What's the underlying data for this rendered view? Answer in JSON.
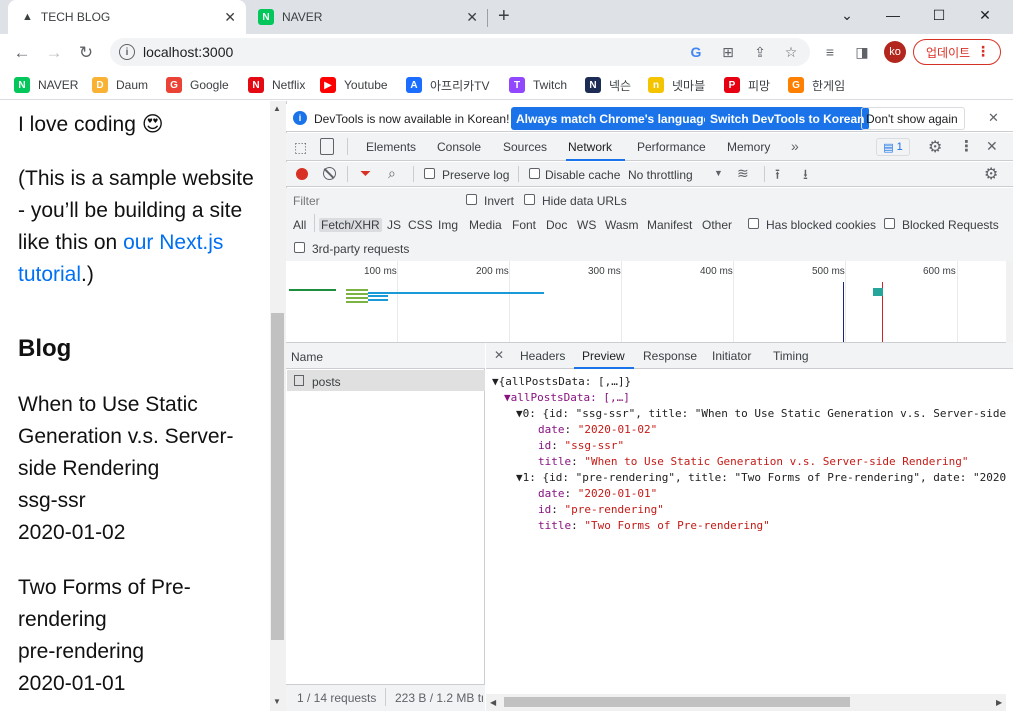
{
  "tabs": [
    {
      "title": "TECH BLOG",
      "close": "✕"
    },
    {
      "title": "NAVER",
      "close": "✕"
    }
  ],
  "new_tab": "+",
  "window_controls": [
    "⌄",
    "—",
    "☐",
    "✕"
  ],
  "address_bar": {
    "url": "localhost:3000"
  },
  "update_button": "업데이트",
  "profile_initials": "ko",
  "bookmarks": [
    {
      "label": "NAVER",
      "icon": "naver-icon",
      "color": "#03c75a",
      "glyph": "N"
    },
    {
      "label": "Daum",
      "icon": "daum-icon",
      "color": "#f9b233",
      "glyph": "D"
    },
    {
      "label": "Google",
      "icon": "google-icon",
      "color": "#ea4335",
      "glyph": "G"
    },
    {
      "label": "Netflix",
      "icon": "netflix-icon",
      "color": "#e50914",
      "glyph": "N"
    },
    {
      "label": "Youtube",
      "icon": "youtube-icon",
      "color": "#ff0000",
      "glyph": "▶"
    },
    {
      "label": "아프리카TV",
      "icon": "afreecatv-icon",
      "color": "#1a6dff",
      "glyph": "A"
    },
    {
      "label": "Twitch",
      "icon": "twitch-icon",
      "color": "#9146ff",
      "glyph": "T"
    },
    {
      "label": "넥슨",
      "icon": "nexon-icon",
      "color": "#1c2c54",
      "glyph": "N"
    },
    {
      "label": "넷마블",
      "icon": "netmarble-icon",
      "color": "#f5c400",
      "glyph": "n"
    },
    {
      "label": "피망",
      "icon": "pmang-icon",
      "color": "#e60012",
      "glyph": "P"
    },
    {
      "label": "한게임",
      "icon": "hangame-icon",
      "color": "#ff7f00",
      "glyph": "G"
    }
  ],
  "page": {
    "intro_line": "I love coding 😍",
    "sample_before": "(This is a sample website - you’ll be building a site like this on ",
    "sample_link": "our Next.js tutorial",
    "sample_after": ".)",
    "blog_heading": "Blog",
    "posts": [
      {
        "title": "When to Use Static Generation v.s. Server-side Rendering",
        "id": "ssg-ssr",
        "date": "2020-01-02"
      },
      {
        "title": "Two Forms of Pre-rendering",
        "id": "pre-rendering",
        "date": "2020-01-01"
      }
    ]
  },
  "devtools": {
    "infobar": {
      "message": "DevTools is now available in Korean!",
      "btn_match": "Always match Chrome's language",
      "btn_switch": "Switch DevTools to Korean",
      "btn_dismiss": "Don't show again"
    },
    "tabs": [
      "Elements",
      "Console",
      "Sources",
      "Network",
      "Performance",
      "Memory"
    ],
    "active_tab": "Network",
    "issues_count": "1",
    "network_toolbar": {
      "preserve_log": "Preserve log",
      "disable_cache": "Disable cache",
      "throttling": "No throttling"
    },
    "filter": {
      "placeholder": "Filter",
      "invert": "Invert",
      "hide_data_urls": "Hide data URLs",
      "types": [
        "All",
        "Fetch/XHR",
        "JS",
        "CSS",
        "Img",
        "Media",
        "Font",
        "Doc",
        "WS",
        "Wasm",
        "Manifest",
        "Other"
      ],
      "active_type": "Fetch/XHR",
      "has_blocked_cookies": "Has blocked cookies",
      "blocked_requests": "Blocked Requests",
      "third_party": "3rd-party requests"
    },
    "timeline_ticks": [
      "100 ms",
      "200 ms",
      "300 ms",
      "400 ms",
      "500 ms",
      "600 ms"
    ],
    "request_list": {
      "header": "Name",
      "requests": [
        "posts"
      ],
      "status": "1 / 14 requests",
      "transfer": "223 B / 1.2 MB tr"
    },
    "detail_tabs": [
      "Headers",
      "Preview",
      "Response",
      "Initiator",
      "Timing"
    ],
    "active_detail_tab": "Preview",
    "preview_lines": [
      {
        "t": "▼{allPostsData: [,…]}"
      },
      {
        "t": "▼allPostsData: [,…]"
      },
      {
        "t": "▼0: {id: \"ssg-ssr\", title: \"When to Use Static Generation v.s. Server-side"
      },
      {
        "k": "date",
        "v": "\"2020-01-02\""
      },
      {
        "k": "id",
        "v": "\"ssg-ssr\""
      },
      {
        "k": "title",
        "v": "\"When to Use Static Generation v.s. Server-side Rendering\""
      },
      {
        "t": "▼1: {id: \"pre-rendering\", title: \"Two Forms of Pre-rendering\", date: \"2020"
      },
      {
        "k": "date",
        "v": "\"2020-01-01\""
      },
      {
        "k": "id",
        "v": "\"pre-rendering\""
      },
      {
        "k": "title",
        "v": "\"Two Forms of Pre-rendering\""
      }
    ]
  },
  "colors": {
    "accent": "#1a73e8",
    "link": "#0070f3",
    "record": "#d93025"
  }
}
